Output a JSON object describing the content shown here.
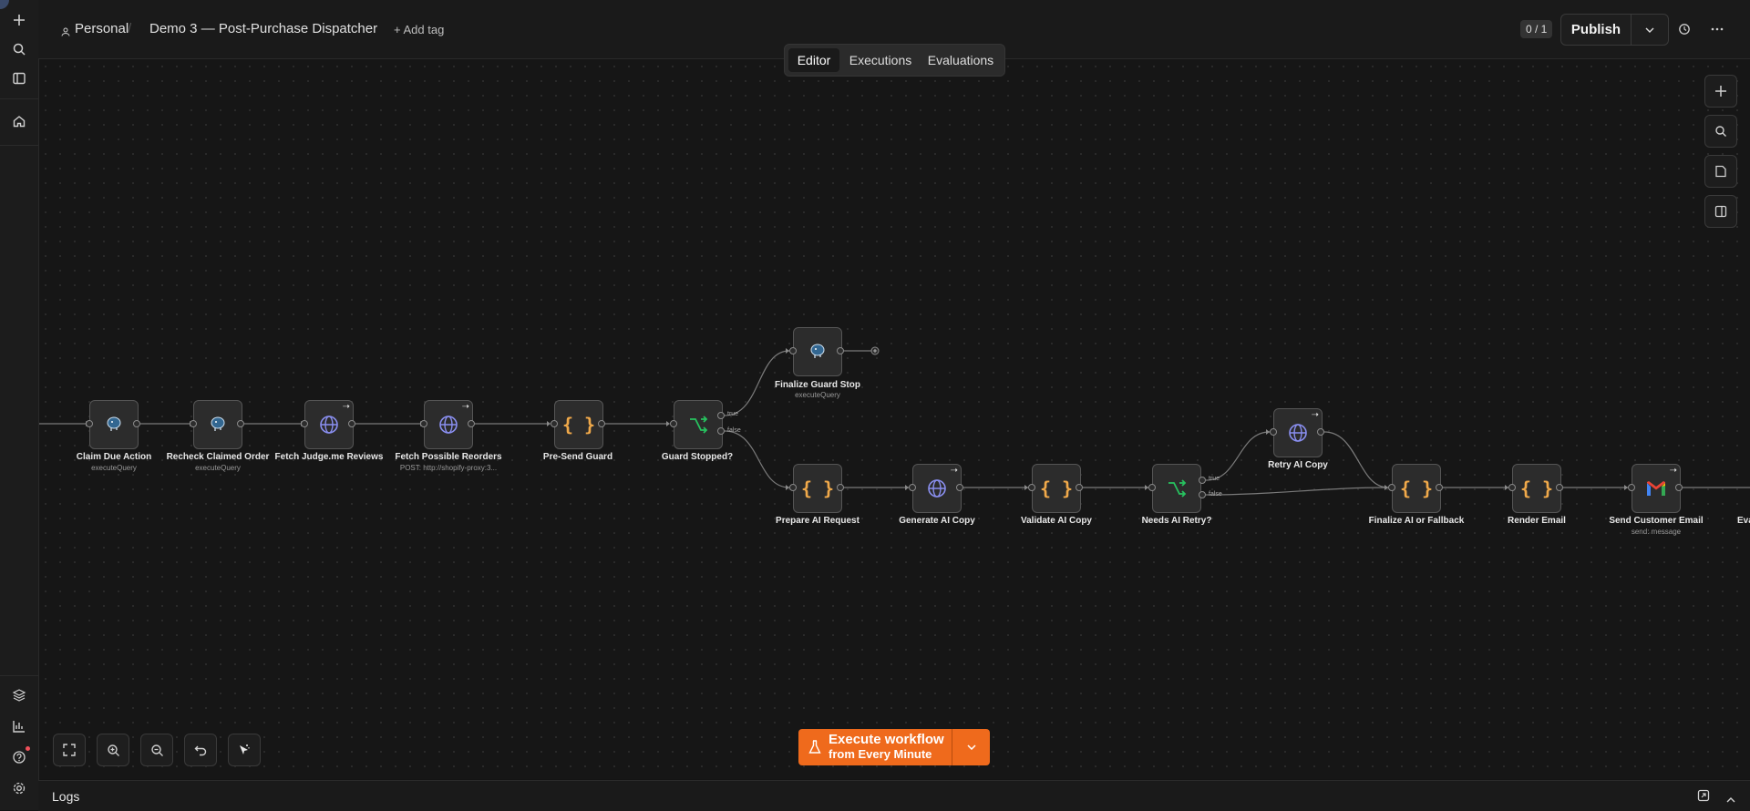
{
  "header": {
    "project": "Personal",
    "workflow_name": "Demo 3 — Post-Purchase Dispatcher",
    "add_tag": "+ Add tag",
    "counter": "0 / 1",
    "publish_label": "Publish"
  },
  "tabs": [
    {
      "label": "Editor",
      "active": true
    },
    {
      "label": "Executions",
      "active": false
    },
    {
      "label": "Evaluations",
      "active": false
    }
  ],
  "nodes": [
    {
      "label": "Claim Due Action",
      "sub": "executeQuery",
      "icon": "postgres-icon"
    },
    {
      "label": "Recheck Claimed Order",
      "sub": "executeQuery",
      "icon": "postgres-icon"
    },
    {
      "label": "Fetch Judge.me Reviews",
      "sub": "",
      "icon": "http-request-icon"
    },
    {
      "label": "Fetch Possible Reorders",
      "sub": "POST: http://shopify-proxy:3...",
      "icon": "http-request-icon"
    },
    {
      "label": "Pre-Send Guard",
      "sub": "",
      "icon": "code-icon"
    },
    {
      "label": "Guard Stopped?",
      "sub": "",
      "icon": "if-branch-icon"
    },
    {
      "label": "Finalize Guard Stop",
      "sub": "executeQuery",
      "icon": "postgres-icon"
    },
    {
      "label": "Prepare AI Request",
      "sub": "",
      "icon": "code-icon"
    },
    {
      "label": "Generate AI Copy",
      "sub": "",
      "icon": "http-request-icon"
    },
    {
      "label": "Validate AI Copy",
      "sub": "",
      "icon": "code-icon"
    },
    {
      "label": "Needs AI Retry?",
      "sub": "",
      "icon": "if-branch-icon"
    },
    {
      "label": "Retry AI Copy",
      "sub": "",
      "icon": "http-request-icon"
    },
    {
      "label": "Finalize AI or Fallback",
      "sub": "",
      "icon": "code-icon"
    },
    {
      "label": "Render Email",
      "sub": "",
      "icon": "code-icon"
    },
    {
      "label": "Send Customer Email",
      "sub": "send: message",
      "icon": "gmail-icon"
    },
    {
      "label": "Eva",
      "sub": "",
      "icon": ""
    }
  ],
  "branch_labels": {
    "true": "true",
    "false": "false"
  },
  "execute": {
    "main": "Execute workflow",
    "sub": "from Every Minute"
  },
  "logs": {
    "title": "Logs"
  },
  "colors": {
    "accent": "#ef6a1c",
    "code": "#f0a94a",
    "if": "#27c25f",
    "http": "#8a8ff0"
  }
}
